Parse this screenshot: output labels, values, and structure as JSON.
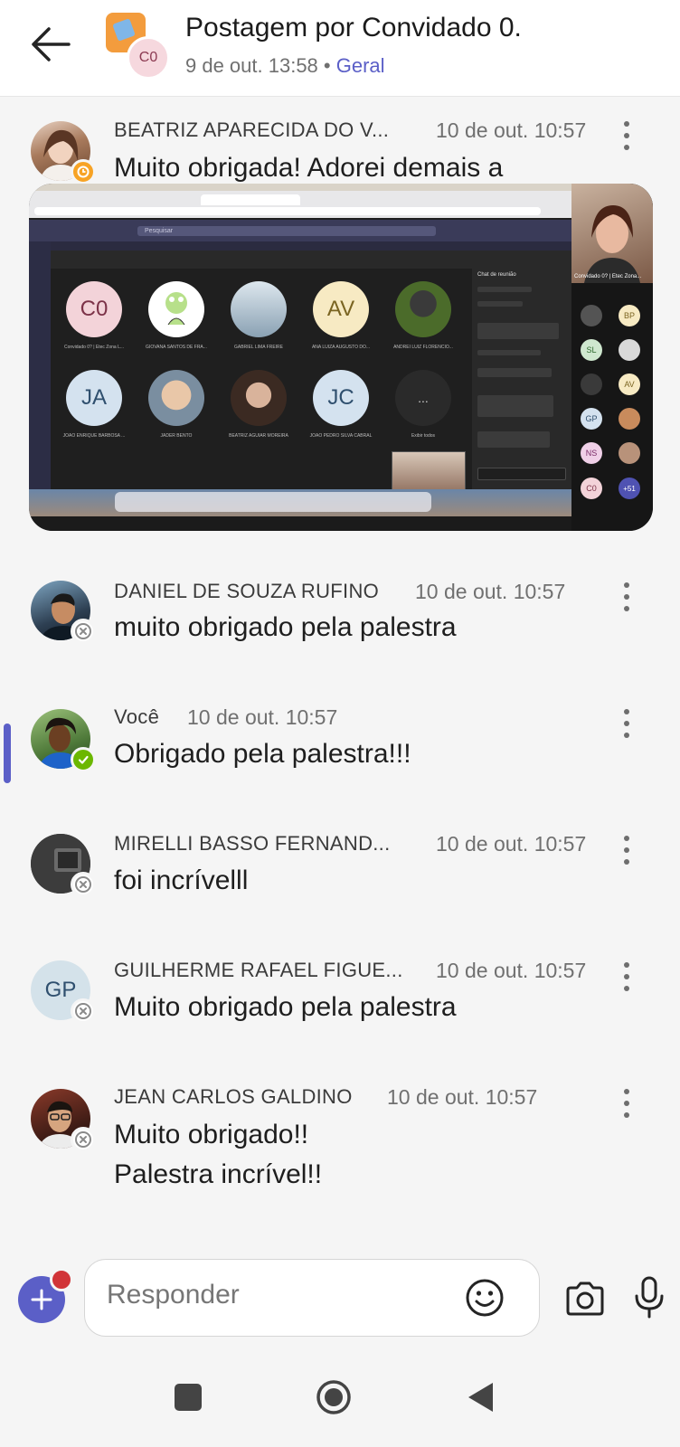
{
  "header": {
    "title": "Postagem por Convidado 0.",
    "date": "9 de out. 13:58",
    "separator": "•",
    "channel": "Geral",
    "avatar_initials": "C0"
  },
  "messages": [
    {
      "author": "BEATRIZ APARECIDA DO V...",
      "time": "10 de out. 10:57",
      "text": "Muito obrigada! Adorei demais a",
      "presence": "away"
    },
    {
      "author": "DANIEL DE SOUZA RUFINO",
      "time": "10 de out. 10:57",
      "text": "muito obrigado pela palestra",
      "presence": "offline"
    },
    {
      "author": "Você",
      "time": "10 de out. 10:57",
      "text": "Obrigado pela palestra!!!",
      "presence": "available"
    },
    {
      "author": "MIRELLI BASSO FERNAND...",
      "time": "10 de out. 10:57",
      "text": "foi incrívelll",
      "presence": "offline"
    },
    {
      "author": "GUILHERME RAFAEL FIGUE...",
      "time": "10 de out. 10:57",
      "text": "Muito obrigado pela palestra",
      "presence": "offline",
      "initials": "GP"
    },
    {
      "author": "JEAN CARLOS GALDINO",
      "time": "10 de out. 10:57",
      "text_line1": "Muito obrigado!!",
      "text_line2": "Palestra incrível!!",
      "presence": "offline"
    }
  ],
  "attachment": {
    "grid_tiles": [
      {
        "initials": "C0",
        "name": "Convidado 0? | Etec Zona L..."
      },
      {
        "initials": "",
        "name": "GIOVANA SANTOS DE FRA..."
      },
      {
        "initials": "",
        "name": "GABRIEL LIMA FREIRE"
      },
      {
        "initials": "AV",
        "name": "ANA LUIZA AUGUSTO DO..."
      },
      {
        "initials": "",
        "name": "ANDREI LUIZ FLORENCIO..."
      },
      {
        "initials": "JA",
        "name": "JOAO ENRIQUE BARBOSA ..."
      },
      {
        "initials": "",
        "name": "JADER BENTO"
      },
      {
        "initials": "",
        "name": "BEATRIZ AGUIAR MOREIRA"
      },
      {
        "initials": "JC",
        "name": "JOAO PEDRO SILVA CABRAL"
      },
      {
        "initials": "...",
        "name": "Exibir todos"
      }
    ],
    "search": "Pesquisar",
    "chat_title": "Chat de reunião",
    "side_tiles": [
      "BP",
      "SL",
      "AV",
      "GP",
      "NS",
      "C0",
      "+51"
    ],
    "speaker": "Convidado 0? | Etec Zona..."
  },
  "compose": {
    "placeholder": "Responder"
  },
  "colors": {
    "accent": "#5b5fc7",
    "notification": "#d13438"
  }
}
